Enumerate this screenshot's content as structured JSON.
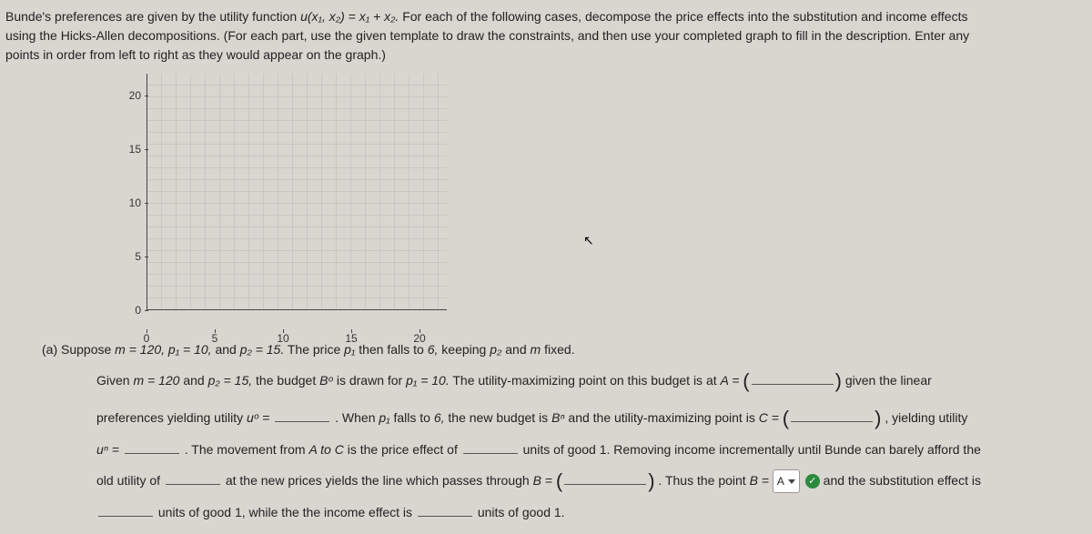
{
  "prompt": {
    "line1_a": "Bunde's preferences are given by the utility function ",
    "utility": "u(x₁, x₂) = x₁ + x₂.",
    "line1_b": " For each of the following cases, decompose the price effects into the substitution and income effects",
    "line2": "using the Hicks-Allen decompositions. (For each part, use the given template to draw the constraints, and then use your completed graph to fill in the description. Enter any",
    "line3": "points in order from left to right as they would appear on the graph.)"
  },
  "chart_data": {
    "type": "scatter",
    "x_ticks": [
      0,
      5,
      10,
      15,
      20
    ],
    "y_ticks": [
      0,
      5,
      10,
      15,
      20
    ],
    "xlim": [
      0,
      22
    ],
    "ylim": [
      0,
      22
    ],
    "series": []
  },
  "qa": {
    "part_a_intro_a": "(a) Suppose ",
    "part_a_vals": "m = 120, p₁ = 10,",
    "part_a_intro_b": " and ",
    "p2val": "p₂ = 15.",
    "part_a_intro_c": " The price ",
    "p1": "p₁",
    "part_a_intro_d": " then falls to ",
    "six": "6,",
    "part_a_intro_e": " keeping ",
    "p2": "p₂",
    "part_a_intro_f": " and ",
    "m": "m",
    "part_a_intro_g": " fixed.",
    "l1_a": "Given ",
    "l1_vals": "m = 120",
    "l1_b": " and ",
    "l1_p2": "p₂ = 15,",
    "l1_c": " the budget ",
    "Bo": "Bᵒ",
    "l1_d": " is drawn for ",
    "l1_p1": "p₁ = 10.",
    "l1_e": " The utility-maximizing point on this budget is at ",
    "A_eq": "A = ",
    "l1_f": " given the linear",
    "l2_a": "preferences yielding utility ",
    "uo": "uᵒ = ",
    "l2_b": ". When ",
    "l2_p1": "p₁",
    "l2_c": " falls to ",
    "l2_six": "6,",
    "l2_d": " the new budget is ",
    "Bn": "Bⁿ",
    "l2_e": " and the utility-maximizing point is ",
    "C_eq": "C = ",
    "l2_f": ", yielding utility",
    "l3_a": "uⁿ = ",
    "l3_b": ". The movement from ",
    "AtoC": "A to C",
    "l3_c": " is the price effect of ",
    "l3_d": " units of good 1. Removing income incrementally until Bunde can barely afford the",
    "l4_a": "old utility of ",
    "l4_b": " at the new prices yields the line which passes through ",
    "B_eq": "B = ",
    "l4_c": ". Thus the point ",
    "B_is": "B = ",
    "dropdown_val": "A",
    "l4_d": " and the substitution effect is",
    "l5_a": " units of good 1, while the the income effect is ",
    "l5_b": " units of good 1."
  }
}
